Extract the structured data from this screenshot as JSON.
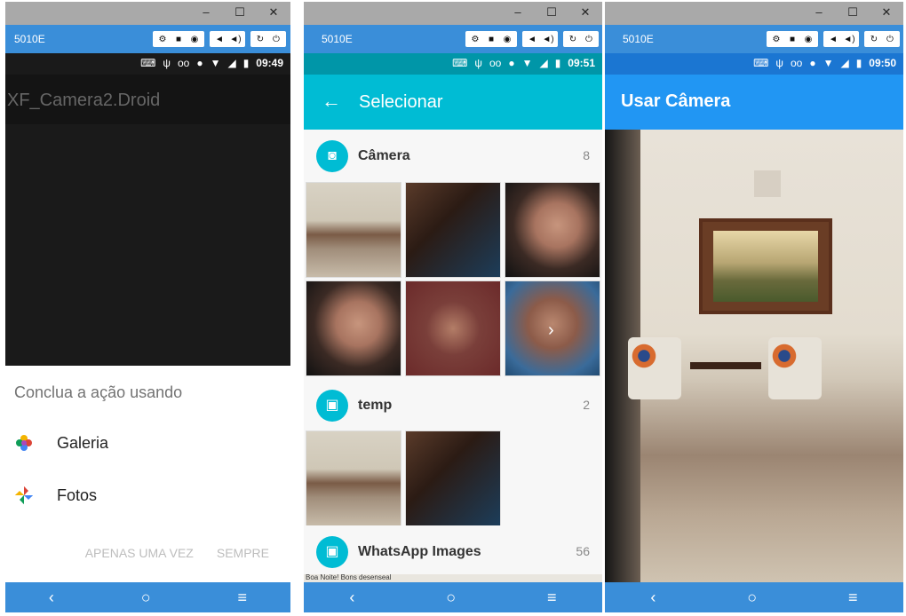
{
  "emulators": [
    {
      "device_name": "5010E",
      "status_time": "09:49",
      "app_title": "XF_Camera2.Droid",
      "sheet": {
        "title": "Conclua a ação usando",
        "items": [
          {
            "label": "Galeria",
            "icon": "gallery-icon"
          },
          {
            "label": "Fotos",
            "icon": "photos-pinwheel-icon"
          }
        ],
        "buttons": [
          "APENAS UMA VEZ",
          "SEMPRE"
        ]
      }
    },
    {
      "device_name": "5010E",
      "status_time": "09:51",
      "app_title": "Selecionar",
      "albums": [
        {
          "name": "Câmera",
          "count": "8",
          "icon": "camera-icon"
        },
        {
          "name": "temp",
          "count": "2",
          "icon": "image-icon"
        },
        {
          "name": "WhatsApp Images",
          "count": "56",
          "icon": "image-icon"
        }
      ],
      "wa_caption": "Boa Noite! Bons desenseal"
    },
    {
      "device_name": "5010E",
      "status_time": "09:50",
      "app_title": "Usar Câmera"
    }
  ],
  "window_controls": [
    "–",
    "☐",
    "✕"
  ],
  "nav": [
    "‹",
    "○",
    "≡"
  ],
  "colors": {
    "device_bar": "#3a8ed9",
    "teal_appbar": "#00bcd4",
    "blue_appbar": "#2196f3"
  }
}
